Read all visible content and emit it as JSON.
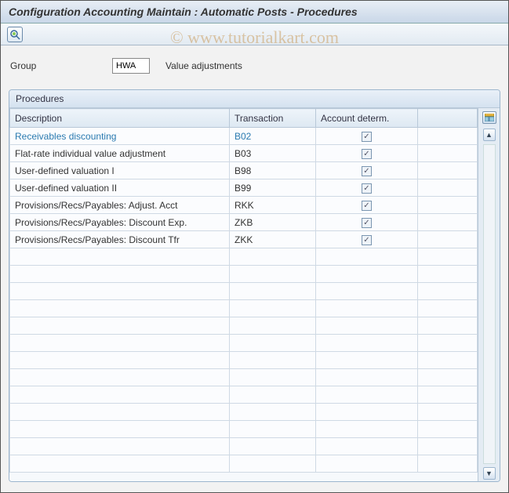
{
  "title": "Configuration Accounting Maintain : Automatic Posts - Procedures",
  "watermark": "© www.tutorialkart.com",
  "group": {
    "label": "Group",
    "value": "HWA",
    "description": "Value adjustments"
  },
  "panel": {
    "title": "Procedures",
    "columns": {
      "description": "Description",
      "transaction": "Transaction",
      "account_determ": "Account determ."
    },
    "rows": [
      {
        "description": "Receivables discounting",
        "transaction": "B02",
        "checked": true,
        "selected": true
      },
      {
        "description": "Flat-rate individual value adjustment",
        "transaction": "B03",
        "checked": true,
        "selected": false
      },
      {
        "description": "User-defined valuation I",
        "transaction": "B98",
        "checked": true,
        "selected": false
      },
      {
        "description": "User-defined valuation II",
        "transaction": "B99",
        "checked": true,
        "selected": false
      },
      {
        "description": "Provisions/Recs/Payables: Adjust. Acct",
        "transaction": "RKK",
        "checked": true,
        "selected": false
      },
      {
        "description": "Provisions/Recs/Payables: Discount Exp.",
        "transaction": "ZKB",
        "checked": true,
        "selected": false
      },
      {
        "description": "Provisions/Recs/Payables: Discount Tfr",
        "transaction": "ZKK",
        "checked": true,
        "selected": false
      }
    ],
    "empty_rows": 13
  }
}
